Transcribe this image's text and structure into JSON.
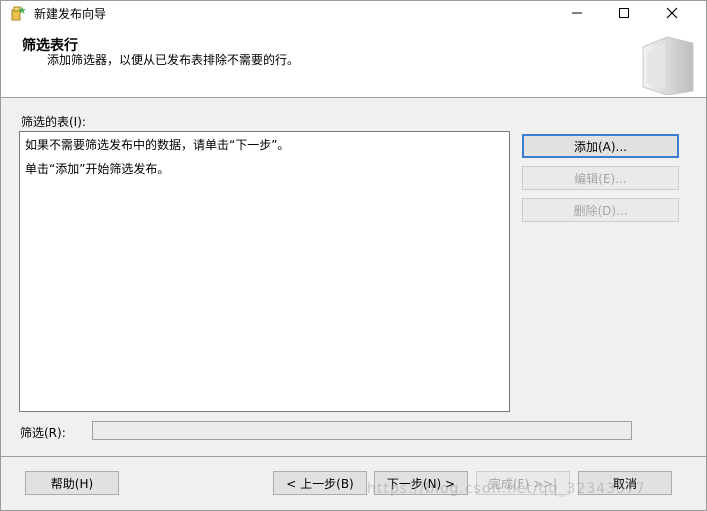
{
  "window": {
    "title": "新建发布向导"
  },
  "header": {
    "title": "筛选表行",
    "subtitle": "添加筛选器，以便从已发布表排除不需要的行。"
  },
  "main": {
    "table_label": "筛选的表(I):",
    "list_lines": [
      "如果不需要筛选发布中的数据，请单击“下一步”。",
      "单击“添加”开始筛选发布。"
    ],
    "add_label": "添加(A)...",
    "edit_label": "编辑(E)...",
    "delete_label": "删除(D)...",
    "filter_label": "筛选(R):",
    "filter_value": ""
  },
  "footer": {
    "help_label": "帮助(H)",
    "back_label": "< 上一步(B)",
    "next_label": "下一步(N) >",
    "finish_label": "完成(F) >>|",
    "cancel_label": "取消"
  },
  "watermark": "https://blog.csdn.net/qq_32343577",
  "colors": {
    "accent": "#3c7fd1",
    "background": "#f0f0f0",
    "disabled_text": "#a6a6a6"
  }
}
